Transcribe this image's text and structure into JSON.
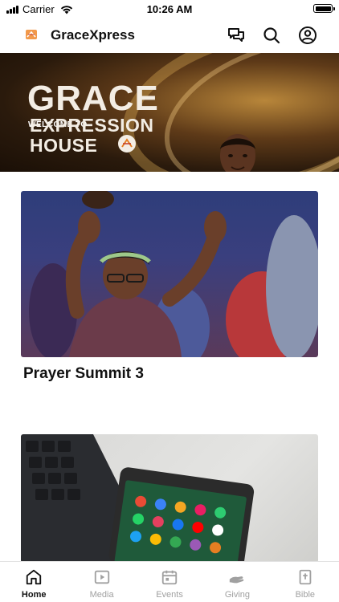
{
  "status_bar": {
    "carrier": "Carrier",
    "time": "10:26 AM"
  },
  "header": {
    "app_title": "GraceXpress",
    "icons": [
      "chat-icon",
      "search-icon",
      "profile-icon"
    ]
  },
  "banner": {
    "welcome": "WELCOME TO",
    "line1": "GRACE",
    "line2": "EXPRESSION",
    "line3": "HOUSE"
  },
  "feed": {
    "cards": [
      {
        "title": "Prayer Summit 3"
      },
      {
        "title": ""
      }
    ]
  },
  "tab_bar": {
    "tabs": [
      {
        "label": "Home",
        "icon": "home-icon",
        "active": true
      },
      {
        "label": "Media",
        "icon": "media-icon",
        "active": false
      },
      {
        "label": "Events",
        "icon": "calendar-icon",
        "active": false
      },
      {
        "label": "Giving",
        "icon": "giving-icon",
        "active": false
      },
      {
        "label": "Bible",
        "icon": "bible-icon",
        "active": false
      }
    ]
  },
  "colors": {
    "active_tab": "#111111",
    "inactive_tab": "#a0a0a0",
    "banner_gold": "#b8863a"
  }
}
